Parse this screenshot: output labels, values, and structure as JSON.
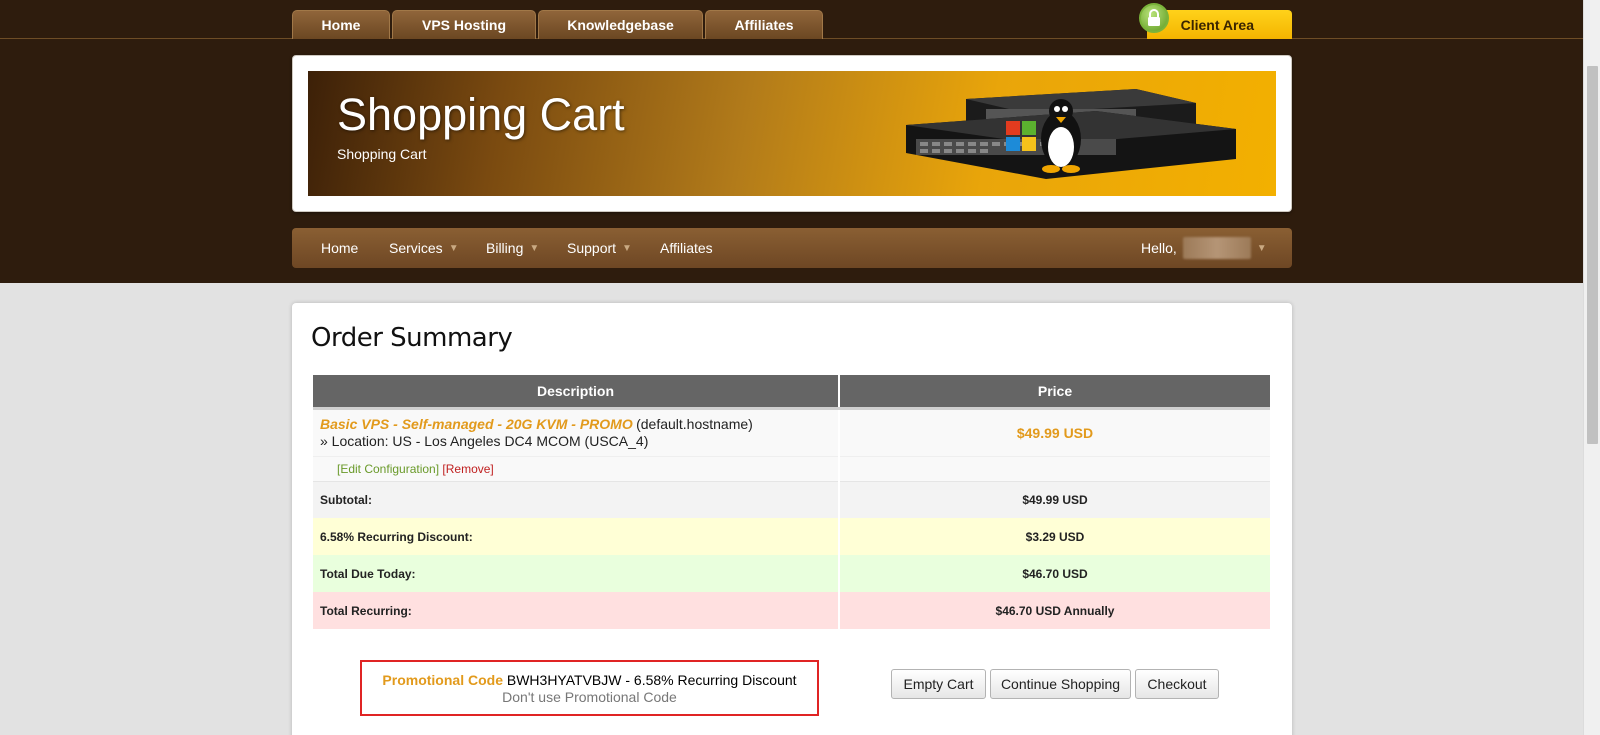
{
  "top_tabs": [
    {
      "label": "Home"
    },
    {
      "label": "VPS Hosting"
    },
    {
      "label": "Knowledgebase"
    },
    {
      "label": "Affiliates"
    }
  ],
  "client_area_label": "Client Area",
  "banner": {
    "title": "Shopping Cart",
    "subtitle": "Shopping Cart"
  },
  "nav": {
    "home": "Home",
    "services": "Services",
    "billing": "Billing",
    "support": "Support",
    "affiliates": "Affiliates",
    "greeting": "Hello,"
  },
  "page_title": "Order Summary",
  "table": {
    "headers": [
      "Description",
      "Price"
    ],
    "item": {
      "product": "Basic VPS - Self-managed - 20G KVM - PROMO",
      "hostname": "(default.hostname)",
      "location": "» Location: US - Los Angeles DC4 MCOM (USCA_4)",
      "price": "$49.99 USD",
      "edit_label": "[Edit Configuration]",
      "remove_label": "[Remove]"
    },
    "summary": [
      {
        "label": "Subtotal:",
        "value": "$49.99 USD"
      },
      {
        "label": "6.58% Recurring Discount:",
        "value": "$3.29 USD"
      },
      {
        "label": "Total Due Today:",
        "value": "$46.70 USD"
      },
      {
        "label": "Total Recurring:",
        "value": "$46.70 USD Annually"
      }
    ]
  },
  "promo": {
    "label": "Promotional Code",
    "value": "BWH3HYATVBJW - 6.58% Recurring Discount",
    "cancel": "Don't use Promotional Code"
  },
  "buttons": {
    "empty_cart": "Empty Cart",
    "continue_shopping": "Continue Shopping",
    "checkout": "Checkout"
  },
  "colors": {
    "header_bg": "#2e1c0d",
    "accent_orange": "#e29a1c",
    "client_area_yellow": "#f4b400",
    "promo_border": "#e02424"
  }
}
